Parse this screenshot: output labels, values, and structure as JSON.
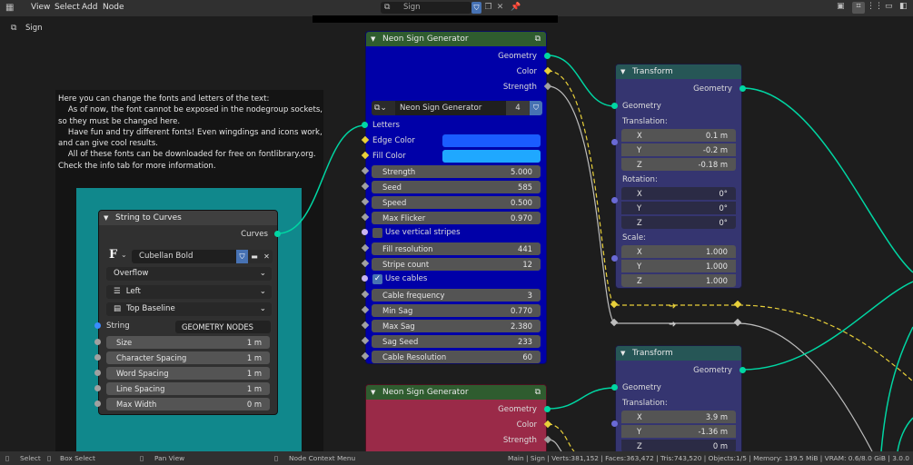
{
  "header": {
    "menu": [
      "View",
      "Select",
      "Add",
      "Node"
    ],
    "nodetree_name": "Sign",
    "breadcrumb": "Sign"
  },
  "info_text": "Here you can change the fonts and letters of the text:\n    As of now, the font cannot be exposed in the nodegroup sockets,\nso they must be changed here.\n    Have fun and try different fonts! Even wingdings and icons work,\nand can give cool results.\n    All of these fonts can be downloaded for free on fontlibrary.org.\nCheck the info tab for more information.",
  "string_to_curves": {
    "title": "String to Curves",
    "output": "Curves",
    "font_glyph": "F",
    "font_name": "Cubellan Bold",
    "overflow": "Overflow",
    "align_x": "Left",
    "align_y": "Top Baseline",
    "string_label": "String",
    "string_value": "GEOMETRY NODES",
    "fields": [
      {
        "label": "Size",
        "value": "1 m"
      },
      {
        "label": "Character Spacing",
        "value": "1 m"
      },
      {
        "label": "Word Spacing",
        "value": "1 m"
      },
      {
        "label": "Line Spacing",
        "value": "1 m"
      },
      {
        "label": "Max Width",
        "value": "0 m"
      }
    ]
  },
  "neon1": {
    "title": "Neon Sign Generator",
    "outputs": [
      "Geometry",
      "Color",
      "Strength"
    ],
    "group_name": "Neon Sign Generator",
    "users": "4",
    "letters": "Letters",
    "edge_color": "Edge Color",
    "fill_color": "Fill Color",
    "edge_color_hex": "#1a5cff",
    "fill_color_hex": "#1fa8ff",
    "fields_a": [
      {
        "label": "Strength",
        "value": "5.000"
      },
      {
        "label": "Seed",
        "value": "585"
      },
      {
        "label": "Speed",
        "value": "0.500"
      },
      {
        "label": "Max Flicker",
        "value": "0.970"
      }
    ],
    "vertical_stripes": "Use vertical stripes",
    "fields_b": [
      {
        "label": "Fill resolution",
        "value": "441"
      },
      {
        "label": "Stripe count",
        "value": "12"
      }
    ],
    "use_cables": "Use cables",
    "fields_c": [
      {
        "label": "Cable frequency",
        "value": "3"
      },
      {
        "label": "Min Sag",
        "value": "0.770"
      },
      {
        "label": "Max Sag",
        "value": "2.380"
      },
      {
        "label": "Sag Seed",
        "value": "233"
      },
      {
        "label": "Cable Resolution",
        "value": "60"
      }
    ]
  },
  "neon2": {
    "title": "Neon Sign Generator",
    "outputs": [
      "Geometry",
      "Color",
      "Strength"
    ]
  },
  "transform1": {
    "title": "Transform",
    "output": "Geometry",
    "input": "Geometry",
    "translation_label": "Translation:",
    "translation": [
      {
        "axis": "X",
        "value": "0.1 m"
      },
      {
        "axis": "Y",
        "value": "-0.2 m"
      },
      {
        "axis": "Z",
        "value": "-0.18 m"
      }
    ],
    "rotation_label": "Rotation:",
    "rotation": [
      {
        "axis": "X",
        "value": "0°"
      },
      {
        "axis": "Y",
        "value": "0°"
      },
      {
        "axis": "Z",
        "value": "0°"
      }
    ],
    "scale_label": "Scale:",
    "scale": [
      {
        "axis": "X",
        "value": "1.000"
      },
      {
        "axis": "Y",
        "value": "1.000"
      },
      {
        "axis": "Z",
        "value": "1.000"
      }
    ]
  },
  "transform2": {
    "title": "Transform",
    "output": "Geometry",
    "input": "Geometry",
    "translation_label": "Translation:",
    "translation": [
      {
        "axis": "X",
        "value": "3.9 m"
      },
      {
        "axis": "Y",
        "value": "-1.36 m"
      },
      {
        "axis": "Z",
        "value": "0 m"
      }
    ]
  },
  "status": {
    "select": "Select",
    "box_select": "Box Select",
    "pan_view": "Pan View",
    "context_menu": "Node Context Menu",
    "stats": "Main | Sign | Verts:381,152 | Faces:363,472 | Tris:743,520 | Objects:1/5 | Memory: 139.5 MiB | VRAM: 0.6/8.0 GiB | 3.0.0"
  }
}
